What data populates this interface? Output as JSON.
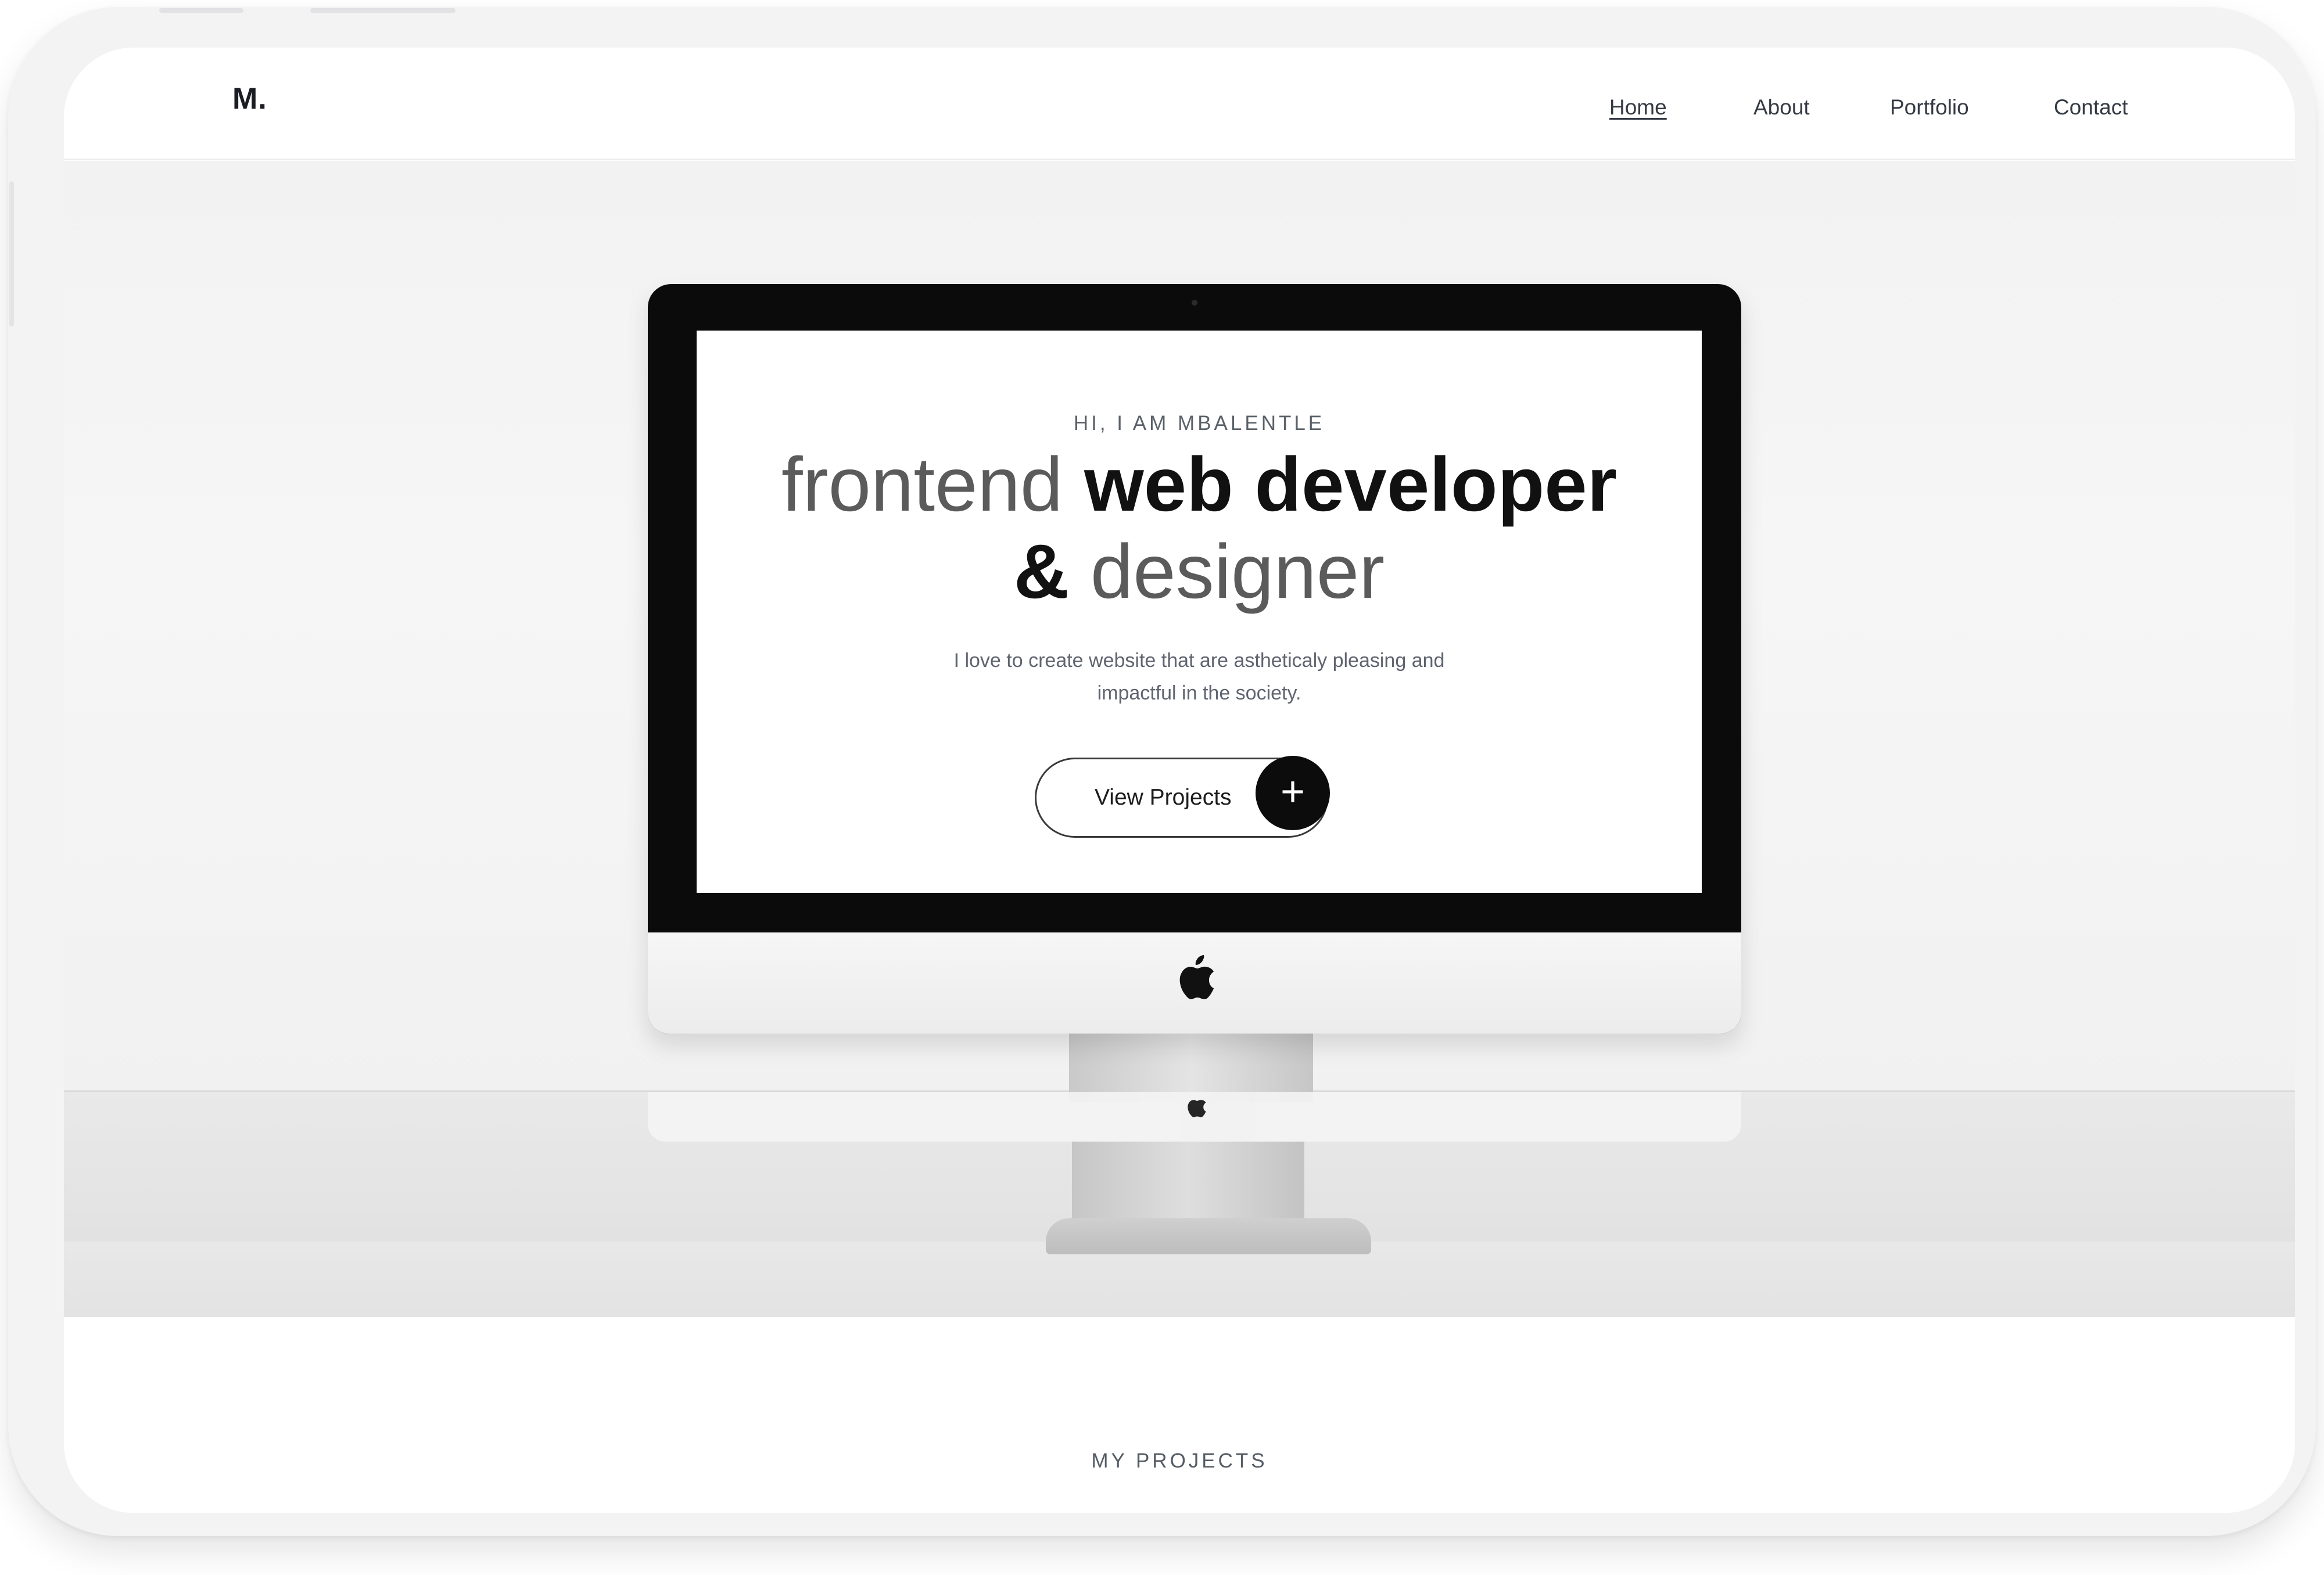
{
  "header": {
    "logo": "M.",
    "nav": [
      {
        "label": "Home",
        "active": true
      },
      {
        "label": "About",
        "active": false
      },
      {
        "label": "Portfolio",
        "active": false
      },
      {
        "label": "Contact",
        "active": false
      }
    ]
  },
  "hero": {
    "intro": "HI, I AM MBALENTLE",
    "headline_thin_1": "frontend",
    "headline_bold_1": "web developer",
    "headline_bold_2": "&",
    "headline_thin_2": "designer",
    "tagline_line1": "I love to create website that are astheticaly pleasing and",
    "tagline_line2": "impactful in the society.",
    "cta_label": "View Projects",
    "cta_icon": "+"
  },
  "projects": {
    "kicker": "MY PROJECTS"
  },
  "colors": {
    "text_dark": "#111111",
    "text_muted": "#5f6470",
    "accent": "#0c0c0c",
    "background": "#f2f2f2"
  }
}
